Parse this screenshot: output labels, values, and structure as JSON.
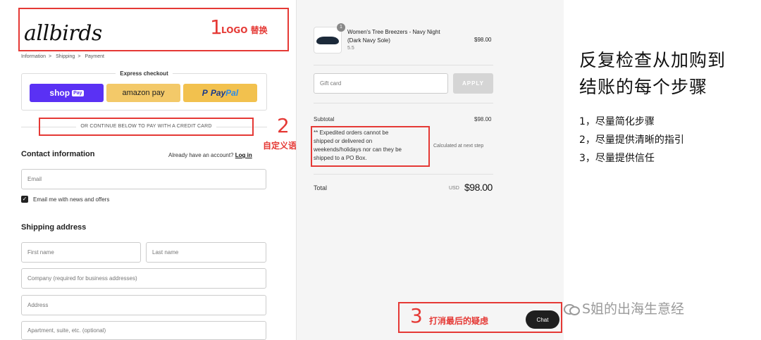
{
  "logo": {
    "text": "allbirds"
  },
  "annotations": {
    "a1": {
      "num": "1",
      "label": "LOGO 替换"
    },
    "a2": {
      "num": "2",
      "label": "自定义语言"
    },
    "a3": {
      "num": "3",
      "label": "打消最后的疑虑"
    }
  },
  "breadcrumb": [
    "Information",
    "Shipping",
    "Payment"
  ],
  "breadcrumb_sep": ">",
  "express": {
    "title": "Express checkout",
    "shop_pay": "shop",
    "shop_pay_badge": "Pay",
    "amazon_pay": "amazon pay",
    "paypal_p": "P",
    "paypal_pay": "Pay",
    "paypal_pal": "Pal"
  },
  "or_continue": "OR CONTINUE BELOW TO PAY WITH A CREDIT CARD",
  "contact": {
    "title": "Contact information",
    "account_prompt": "Already have an account?",
    "login_link": "Log in",
    "email_placeholder": "Email",
    "newsletter_label": "Email me with news and offers",
    "check_mark": "✓"
  },
  "shipping": {
    "title": "Shipping address",
    "first_name": "First name",
    "last_name": "Last name",
    "company": "Company (required for business addresses)",
    "address": "Address",
    "apartment": "Apartment, suite, etc. (optional)"
  },
  "summary": {
    "product_name_1": "Women's Tree Breezers - Navy Night",
    "product_name_2": "(Dark Navy Sole)",
    "product_variant": "5.5",
    "product_qty": "1",
    "product_price": "$98.00",
    "gift_placeholder": "Gift card",
    "apply_label": "APPLY",
    "subtotal_label": "Subtotal",
    "subtotal_value": "$98.00",
    "shipping_note_1": "** Expedited orders cannot be",
    "shipping_note_2": "shipped or delivered on",
    "shipping_note_3": "weekends/holidays nor can they be",
    "shipping_note_4": "shipped to a PO Box.",
    "shipping_value": "Calculated at next step",
    "total_label": "Total",
    "total_currency": "USD",
    "total_value": "$98.00",
    "chat_label": "Chat"
  },
  "side_notes": {
    "headline_1": "反复检查从加购到",
    "headline_2": "结账的每个步骤",
    "items": [
      "1，尽量简化步骤",
      "2，尽量提供清晰的指引",
      "3，尽量提供信任"
    ]
  },
  "watermark": "S姐的出海生意经",
  "colors": {
    "annotation_red": "#e53935",
    "shop_pay_purple": "#5a31f4",
    "paypal_yellow": "#f2c14e"
  }
}
